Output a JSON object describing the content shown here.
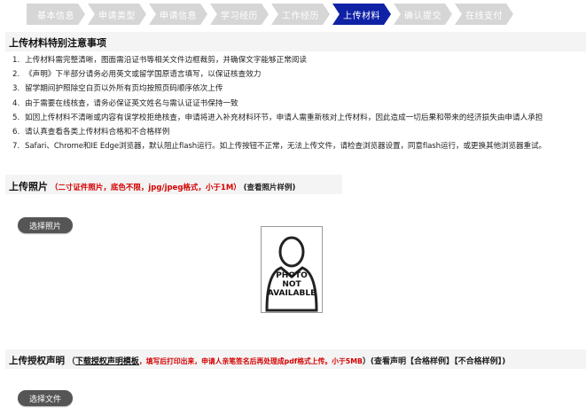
{
  "steps": [
    {
      "label": "基本信息",
      "active": false
    },
    {
      "label": "申请类型",
      "active": false
    },
    {
      "label": "申请信息",
      "active": false
    },
    {
      "label": "学习经历",
      "active": false
    },
    {
      "label": "工作经历",
      "active": false
    },
    {
      "label": "上传材料",
      "active": true
    },
    {
      "label": "确认提交",
      "active": false
    },
    {
      "label": "在线支付",
      "active": false
    }
  ],
  "notice": {
    "title": "上传材料特别注意事项",
    "items": [
      {
        "num": "1.",
        "text": "上传材料需完整清晰，图面需沿证书等相关文件边框裁剪，并确保文字能够正常阅读"
      },
      {
        "num": "2.",
        "text": "《声明》下半部分请务必用英文或留学国原语言填写，以保证核查效力"
      },
      {
        "num": "3.",
        "text": "留学期间护照除空白页以外所有页均按照页码顺序依次上传"
      },
      {
        "num": "4.",
        "text": "由于需要在线核查，请务必保证英文姓名与需认证证书保持一致"
      },
      {
        "num": "5.",
        "text": "如因上传材料不清晰或内容有误学校拒绝核查，申请将进入补充材料环节，申请人需重新核对上传材料，因此造成一切后果和带来的经济损失由申请人承担"
      },
      {
        "num": "6.",
        "text": "请认真查看各类上传材料合格和不合格样例"
      },
      {
        "num": "7.",
        "text": "Safari、Chrome和IE Edge浏览器，默认阻止flash运行。如上传按钮不正常，无法上传文件，请检查浏览器设置，同意flash运行，或更换其他浏览器重试。"
      }
    ]
  },
  "photo_section": {
    "title": "上传照片",
    "requirement": "（二寸证件照片，底色不限，jpg/jpeg格式，小于1M）",
    "sample_link": "(查看照片样例)",
    "button": "选择照片",
    "placeholder_lines": [
      "PHOTO",
      "NOT",
      "AVAILABLE"
    ]
  },
  "auth_section": {
    "title": "上传授权声明",
    "open_paren": "（",
    "download_link": "下载授权声明模板",
    "instruction": "，填写后打印出来，申请人亲笔签名后再处理成pdf格式上传。小于5MB",
    "close_paren": "）",
    "view_prefix": "(查看声明",
    "qualified": "【合格样例】",
    "unqualified": "【不合格样例】",
    "view_suffix": ")",
    "button": "选择文件"
  }
}
